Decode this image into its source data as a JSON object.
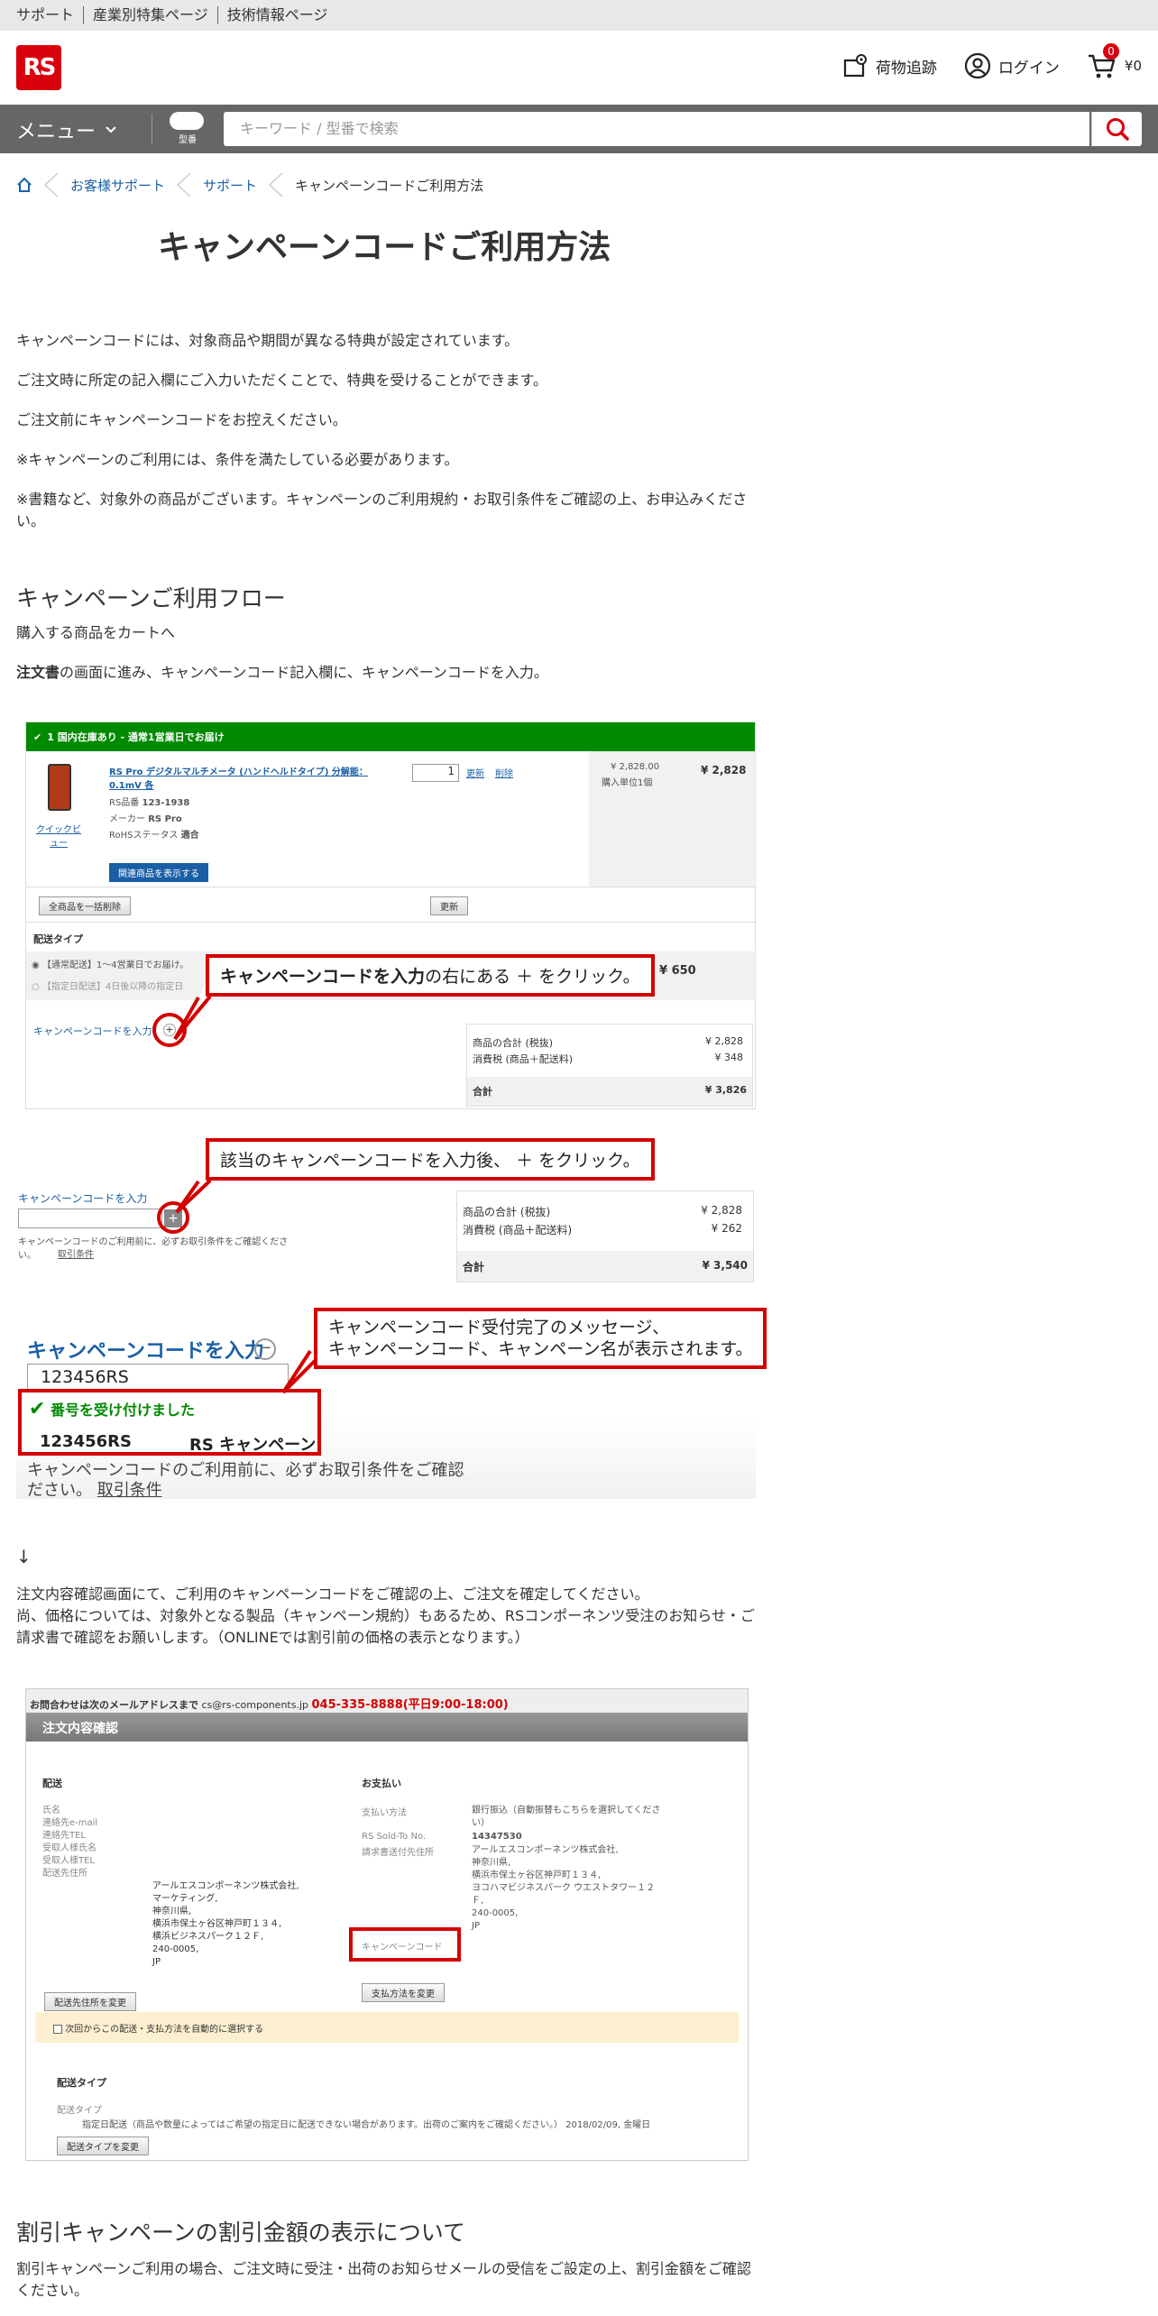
{
  "topbar": {
    "links": [
      "サポート",
      "産業別特集ページ",
      "技術情報ページ"
    ]
  },
  "header": {
    "logo": "RS",
    "tracking": "荷物追跡",
    "login": "ログイン",
    "cart_count": "0",
    "cart_total": "¥0"
  },
  "nav": {
    "menu": "メニュー",
    "kataban": "型番",
    "search_placeholder": "キーワード / 型番で検索"
  },
  "breadcrumb": [
    "お客様サポート",
    "サポート",
    "キャンペーンコードご利用方法"
  ],
  "page_title": "キャンペーンコードご利用方法",
  "intro": [
    "キャンペーンコードには、対象商品や期間が異なる特典が設定されています。",
    "ご注文時に所定の記入欄にご入力いただくことで、特典を受けることができます。",
    "ご注文前にキャンペーンコードをお控えください。",
    "※キャンペーンのご利用には、条件を満たしている必要があります。",
    "※書籍など、対象外の商品がございます。キャンペーンのご利用規約・お取引条件をご確認の上、お申込みください。"
  ],
  "flow": {
    "heading": "キャンペーンご利用フロー",
    "step1": "購入する商品をカートへ",
    "step2_bold": "注文書",
    "step2_rest": "の画面に進み、キャンペーンコード記入欄に、キャンペーンコードを入力。"
  },
  "shot1": {
    "banner": "1 国内在庫あり - 通常1営業日でお届け",
    "product_name": "RS Pro デジタルマルチメータ (ハンドヘルドタイプ) 分解能：0.1mV 各",
    "rs_code_label": "RS品番",
    "rs_code": "123-1938",
    "maker_label": "メーカー",
    "maker": "RS Pro",
    "rohs_label": "RoHSステータス",
    "rohs": "適合",
    "quick_view": "クイックビュー",
    "qty": "1",
    "update": "更新",
    "delete": "削除",
    "unit_price": "¥ 2,828.00",
    "unit_note": "購入単位1個",
    "line_total": "¥ 2,828",
    "related_btn": "関連商品を表示する",
    "delete_all_btn": "全商品を一括削除",
    "refresh_btn": "更新",
    "delivery_type": "配送タイプ",
    "delivery_opt1": "【通常配送】1〜4営業日でお届け。",
    "delivery_opt2": "【指定日配送】4日後以降の指定日",
    "shipping": "¥ 650",
    "campaign_label": "キャンペーンコードを入力",
    "callout_bold": "キャンペーンコードを入力",
    "callout_rest": "の右にある ＋ をクリック。",
    "subtotal_label": "商品の合計 (税抜)",
    "subtotal": "¥ 2,828",
    "tax_label": "消費税 (商品＋配送料)",
    "tax": "¥ 348",
    "total_label": "合計",
    "total": "¥ 3,826"
  },
  "shot2": {
    "campaign_label": "キャンペーンコードを入力",
    "callout": "該当のキャンペーンコードを入力後、 ＋ をクリック。",
    "note": "キャンペーンコードのご利用前に、必ずお取引条件をご確認ください。",
    "terms": "取引条件",
    "subtotal_label": "商品の合計 (税抜)",
    "subtotal": "¥ 2,828",
    "tax_label": "消費税 (商品＋配送料)",
    "tax": "¥ 262",
    "total_label": "合計",
    "total": "¥ 3,540"
  },
  "shot3": {
    "campaign_label": "キャンペーンコードを入力",
    "code_value": "123456RS",
    "accepted": "番号を受け付けました",
    "code": "123456RS",
    "campaign_name": "RS キャンペーン",
    "callout_line1": "キャンペーンコード受付完了のメッセージ、",
    "callout_line2": "キャンペーンコード、キャンペーン名が表示されます。",
    "note": "キャンペーンコードのご利用前に、必ずお取引条件をご確認",
    "note2": "ださい。",
    "terms": "取引条件"
  },
  "arrow": "↓",
  "confirm_text": [
    "注文内容確認画面にて、ご利用のキャンペーンコードをご確認の上、ご注文を確定してください。",
    "尚、価格については、対象外となる製品（キャンペーン規約）もあるため、RSコンポーネンツ受注のお知らせ・ご請求書で確認をお願いします。（ONLINEでは割引前の価格の表示となります。）"
  ],
  "shot4": {
    "contact_prefix": "お問合わせは次のメールアドレスまで",
    "contact_email": "cs@rs-components.jp",
    "contact_phone": "045-335-8888(平日9:00-18:00)",
    "title": "注文内容確認",
    "ship_heading": "配送",
    "ship_labels": [
      "氏名",
      "連絡先e-mail",
      "連絡先TEL",
      "受取人様氏名",
      "受取人様TEL",
      "配送先住所"
    ],
    "ship_address": [
      "アールエスコンポーネンツ株式会社,",
      "マーケティング,",
      "神奈川県,",
      "横浜市保土ヶ谷区神戸町１３４,",
      "横浜ビジネスパーク１２Ｆ,",
      "240-0005,",
      "JP"
    ],
    "ship_btn": "配送先住所を変更",
    "pay_heading": "お支払い",
    "pay_method_label": "支払い方法",
    "pay_method": "銀行振込（自動振替もこちらを選択してください）",
    "sold_to_label": "RS Sold-To No.",
    "sold_to": "14347530",
    "bill_label": "請求書送付先住所",
    "bill_address": [
      "アールエスコンポーネンツ株式会社,",
      "神奈川県,",
      "横浜市保土ヶ谷区神戸町１３４,",
      "ヨコハマビジネスパーク ウエストタワー１２Ｆ,",
      "240-0005,",
      "JP"
    ],
    "campaign_label": "キャンペーンコード",
    "pay_btn": "支払方法を変更",
    "auto_select": "次回からこの配送・支払方法を自動的に選択する",
    "dtype_heading": "配送タイプ",
    "dtype_label": "配送タイプ",
    "dtype_value": "指定日配送（商品や数量によってはご希望の指定日に配送できない場合があります。出荷のご案内をご確認ください。） 2018/02/09, 金曜日",
    "dtype_btn": "配送タイプを変更"
  },
  "discount": {
    "heading": "割引キャンペーンの割引金額の表示について",
    "text": "割引キャンペーンご利用の場合、ご注文時に受注・出荷のお知らせメールの受信をご設定の上、割引金額をご確認ください。"
  },
  "colors": {
    "brand_red": "#d9000d",
    "callout_red": "#d40000",
    "green": "#008a00",
    "link_blue": "#1a5fa6",
    "nav_gray": "#666666"
  }
}
